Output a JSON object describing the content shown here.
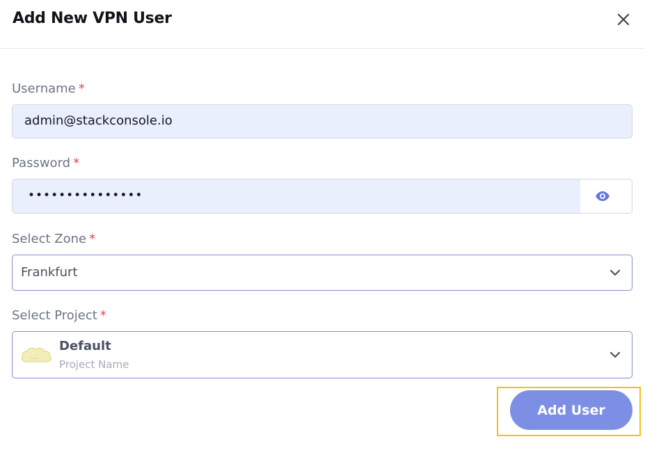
{
  "dialog": {
    "title": "Add New VPN User"
  },
  "form": {
    "required_marker": "*",
    "username": {
      "label": "Username",
      "value": "admin@stackconsole.io"
    },
    "password": {
      "label": "Password",
      "value": "•••••••••••••••"
    },
    "zone": {
      "label": "Select Zone",
      "value": "Frankfurt"
    },
    "project": {
      "label": "Select Project",
      "value": "Default",
      "sublabel": "Project Name"
    }
  },
  "actions": {
    "add_user_label": "Add User"
  },
  "colors": {
    "accent": "#7d8fe4",
    "required": "#e5484d",
    "highlight": "#f2c01a",
    "input_fill": "#e9effd"
  },
  "icons": {
    "close": "close-icon",
    "visibility": "eye-icon",
    "dropdown": "chevron-down-icon",
    "project": "cloud-icon"
  }
}
